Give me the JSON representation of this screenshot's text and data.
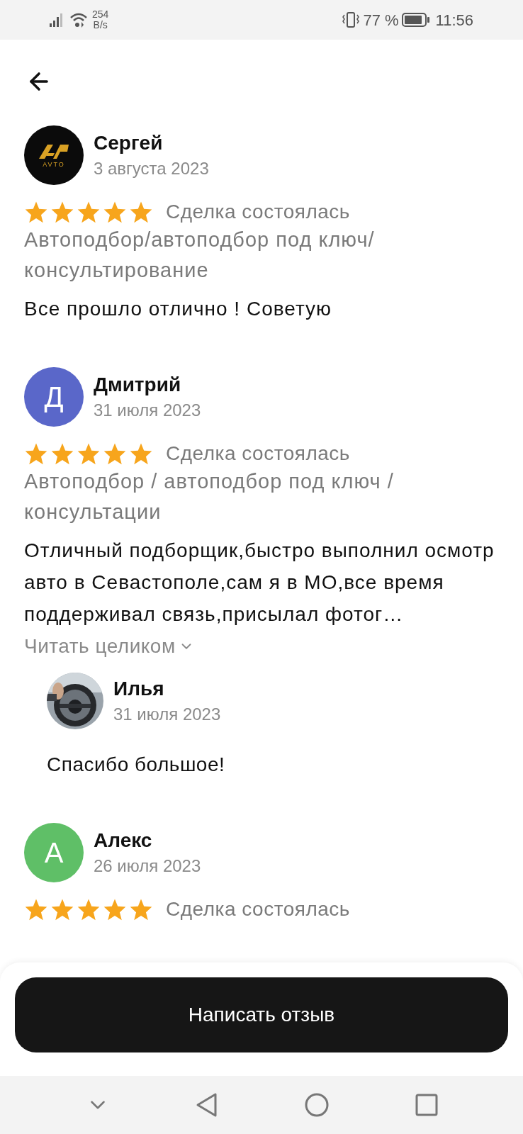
{
  "status_bar": {
    "speed_value": "254",
    "speed_unit": "B/s",
    "battery": "77 %",
    "time": "11:56"
  },
  "reviews": [
    {
      "name": "Сергей",
      "date": "3 августа 2023",
      "avatar": {
        "kind": "logo",
        "logo_text": "AVTO"
      },
      "stars": 5,
      "status": "Сделка состоялась",
      "category": "Автоподбор/автоподбор под ключ/ консультирование",
      "text": "Все прошло отлично ! Советую"
    },
    {
      "name": "Дмитрий",
      "date": "31 июля 2023",
      "avatar": {
        "kind": "letter",
        "letter": "Д",
        "color": "#5a67c9"
      },
      "stars": 5,
      "status": "Сделка состоялась",
      "category": "Автоподбор / автоподбор под ключ / консультации",
      "text": "Отличный подборщик,быстро выполнил осмотр авто в Севастополе,сам я в МО,все время поддерживал связь,присылал фотог…",
      "read_more": "Читать целиком",
      "replies": [
        {
          "name": "Илья",
          "date": "31 июля 2023",
          "text": "Спасибо большое!"
        }
      ]
    },
    {
      "name": "Алекс",
      "date": "26 июля 2023",
      "avatar": {
        "kind": "letter",
        "letter": "А",
        "color": "#5fbf67"
      },
      "stars": 5,
      "status": "Сделка состоялась"
    }
  ],
  "write_button": "Написать отзыв"
}
